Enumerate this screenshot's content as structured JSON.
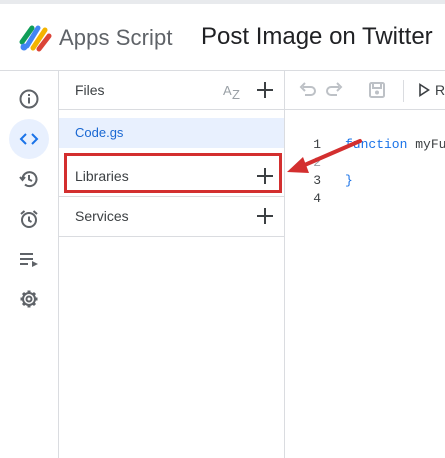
{
  "header": {
    "app_name": "Apps Script",
    "project_title": "Post Image on Twitter"
  },
  "rail": {
    "items": [
      {
        "icon": "info-icon",
        "label": "Overview"
      },
      {
        "icon": "code-icon",
        "label": "Editor",
        "active": true
      },
      {
        "icon": "history-icon",
        "label": "Project history"
      },
      {
        "icon": "alarm-icon",
        "label": "Triggers"
      },
      {
        "icon": "executions-icon",
        "label": "Executions"
      },
      {
        "icon": "gear-icon",
        "label": "Project Settings"
      }
    ]
  },
  "files_panel": {
    "title": "Files",
    "file_name": "Code.gs",
    "libraries_label": "Libraries",
    "services_label": "Services"
  },
  "editor": {
    "run_label": "R",
    "line_numbers": [
      "1",
      "2",
      "3",
      "4"
    ],
    "code_keyword": "function",
    "code_fn": "myFu",
    "code_close": "}"
  },
  "annotation": {
    "highlight_color": "#d32f2f",
    "target": "Libraries"
  },
  "colors": {
    "accent": "#1a73e8",
    "active_bg": "#e8f0fe",
    "border": "#dadce0"
  }
}
